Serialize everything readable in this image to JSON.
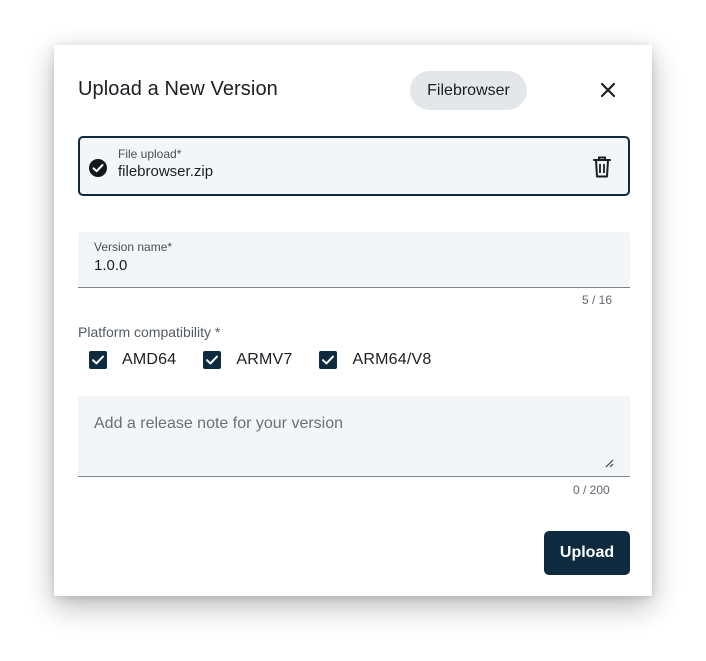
{
  "dialog": {
    "title": "Upload a New Version",
    "badge": "Filebrowser",
    "close_icon": "close-icon"
  },
  "file_upload": {
    "label": "File upload*",
    "value": "filebrowser.zip",
    "status_icon": "check-circle-icon",
    "delete_icon": "trash-icon"
  },
  "version_name": {
    "label": "Version name*",
    "value": "1.0.0",
    "counter": "5 / 16"
  },
  "platform": {
    "label": "Platform compatibility *",
    "options": [
      {
        "label": "AMD64",
        "checked": true
      },
      {
        "label": "ARMV7",
        "checked": true
      },
      {
        "label": "ARM64/V8",
        "checked": true
      }
    ]
  },
  "release_note": {
    "placeholder": "Add a release note for your version",
    "value": "",
    "counter": "0 / 200"
  },
  "actions": {
    "upload_label": "Upload"
  },
  "colors": {
    "primary": "#0e2a3f",
    "field_bg": "#f3f5f7",
    "badge_bg": "#e4e7ea"
  }
}
